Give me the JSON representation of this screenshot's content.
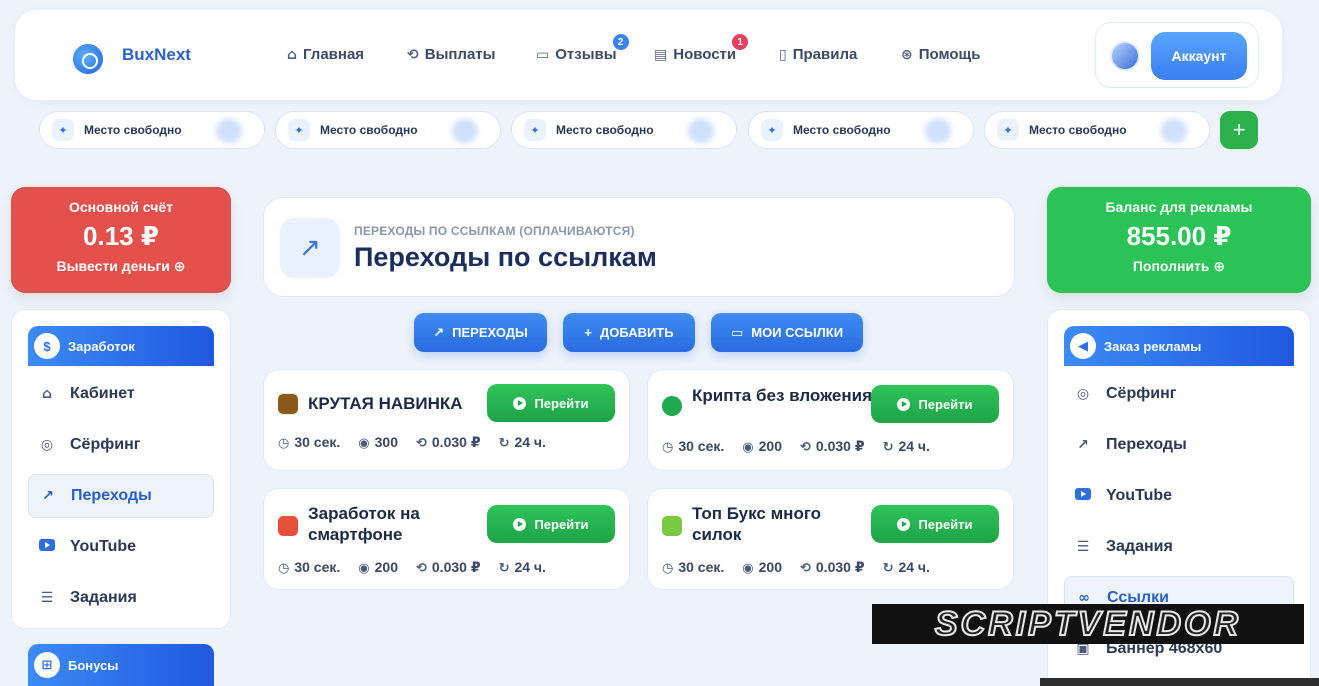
{
  "brand": {
    "name": "BuxNext"
  },
  "nav": {
    "items": [
      {
        "label": "Главная",
        "icon": "home-icon",
        "glyph": "⌂"
      },
      {
        "label": "Выплаты",
        "icon": "payout-icon",
        "glyph": "⟲"
      },
      {
        "label": "Отзывы",
        "icon": "reviews-icon",
        "glyph": "▭",
        "badge": "2"
      },
      {
        "label": "Новости",
        "icon": "news-icon",
        "glyph": "▤",
        "badge": "1"
      },
      {
        "label": "Правила",
        "icon": "rules-icon",
        "glyph": "▯"
      },
      {
        "label": "Помощь",
        "icon": "help-icon",
        "glyph": "⊛"
      }
    ],
    "account_label": "Аккаунт"
  },
  "slots": {
    "items": [
      "Место свободно",
      "Место свободно",
      "Место свободно",
      "Место свободно",
      "Место свободно"
    ],
    "add_label": "+"
  },
  "balances": {
    "main": {
      "title": "Основной счёт",
      "value": "0.13 ₽",
      "action": "Вывести деньги"
    },
    "ads": {
      "title": "Баланс для рекламы",
      "value": "855.00 ₽",
      "action": "Пополнить"
    }
  },
  "left_menu": {
    "header": "Заработок",
    "items": [
      "Кабинет",
      "Сёрфинг",
      "Переходы",
      "YouTube",
      "Задания"
    ],
    "active_index": 2,
    "bonus_header": "Бонусы"
  },
  "right_menu": {
    "header": "Заказ рекламы",
    "items": [
      "Сёрфинг",
      "Переходы",
      "YouTube",
      "Задания",
      "Ссылки",
      "Баннер 468x60"
    ],
    "active_index": 4
  },
  "page": {
    "subtitle": "ПЕРЕХОДЫ ПО ССЫЛКАМ (ОПЛАЧИВАЮТСЯ)",
    "title": "Переходы по ссылкам"
  },
  "actions": {
    "transitions": "ПЕРЕХОДЫ",
    "add": "ДОБАВИТЬ",
    "my_links": "МОИ ССЫЛКИ"
  },
  "tasks": [
    {
      "title": "КРУТАЯ НАВИНКА",
      "time": "30 сек.",
      "views": "300",
      "price": "0.030 ₽",
      "period": "24 ч.",
      "button": "Перейти",
      "icon_color": "#8a5a1c"
    },
    {
      "title": "Крипта без вложения",
      "time": "30 сек.",
      "views": "200",
      "price": "0.030 ₽",
      "period": "24 ч.",
      "button": "Перейти",
      "icon_color": "#1fa84c"
    },
    {
      "title": "Заработок на смартфоне",
      "time": "30 сек.",
      "views": "200",
      "price": "0.030 ₽",
      "period": "24 ч.",
      "button": "Перейти",
      "icon_color": "#e6503a"
    },
    {
      "title": "Топ Букс много силок",
      "time": "30 сек.",
      "views": "200",
      "price": "0.030 ₽",
      "period": "24 ч.",
      "button": "Перейти",
      "icon_color": "#7ac943"
    }
  ],
  "watermark": {
    "text": "SCRIPTVENDOR"
  },
  "colors": {
    "accent_blue": "#2f6fe0",
    "main_balance_red": "#e4514d",
    "ads_balance_green": "#2bc257",
    "go_button_green": "#1ea347"
  }
}
